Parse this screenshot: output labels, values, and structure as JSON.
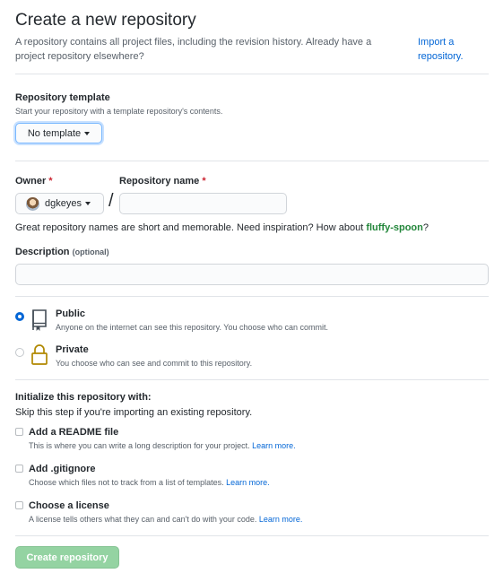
{
  "header": {
    "title": "Create a new repository",
    "subtitle": "A repository contains all project files, including the revision history. Already have a project repository elsewhere?",
    "import_link": "Import a repository."
  },
  "template": {
    "label": "Repository template",
    "note": "Start your repository with a template repository's contents.",
    "button": "No template"
  },
  "owner": {
    "label": "Owner",
    "required": "*",
    "value": "dgkeyes"
  },
  "slash": "/",
  "repo_name": {
    "label": "Repository name",
    "required": "*",
    "value": ""
  },
  "suggestion": {
    "prefix": "Great repository names are short and memorable. Need inspiration? How about ",
    "name": "fluffy-spoon",
    "suffix": "?"
  },
  "description": {
    "label": "Description",
    "optional": "(optional)",
    "value": ""
  },
  "visibility": {
    "public": {
      "title": "Public",
      "desc": "Anyone on the internet can see this repository. You choose who can commit.",
      "selected": true
    },
    "private": {
      "title": "Private",
      "desc": "You choose who can see and commit to this repository.",
      "selected": false
    }
  },
  "init": {
    "title": "Initialize this repository with:",
    "note": "Skip this step if you're importing an existing repository.",
    "readme": {
      "title": "Add a README file",
      "desc": "This is where you can write a long description for your project.",
      "link": "Learn more."
    },
    "gitignore": {
      "title": "Add .gitignore",
      "desc": "Choose which files not to track from a list of templates.",
      "link": "Learn more."
    },
    "license": {
      "title": "Choose a license",
      "desc": "A license tells others what they can and can't do with your code.",
      "link": "Learn more."
    }
  },
  "submit": {
    "label": "Create repository"
  },
  "colors": {
    "accent": "#0366d6",
    "suggestion": "#22863a",
    "required": "#cb2431",
    "submit_disabled": "#94d3a2"
  },
  "icons": {
    "public": "repo-icon",
    "private": "lock-icon"
  }
}
